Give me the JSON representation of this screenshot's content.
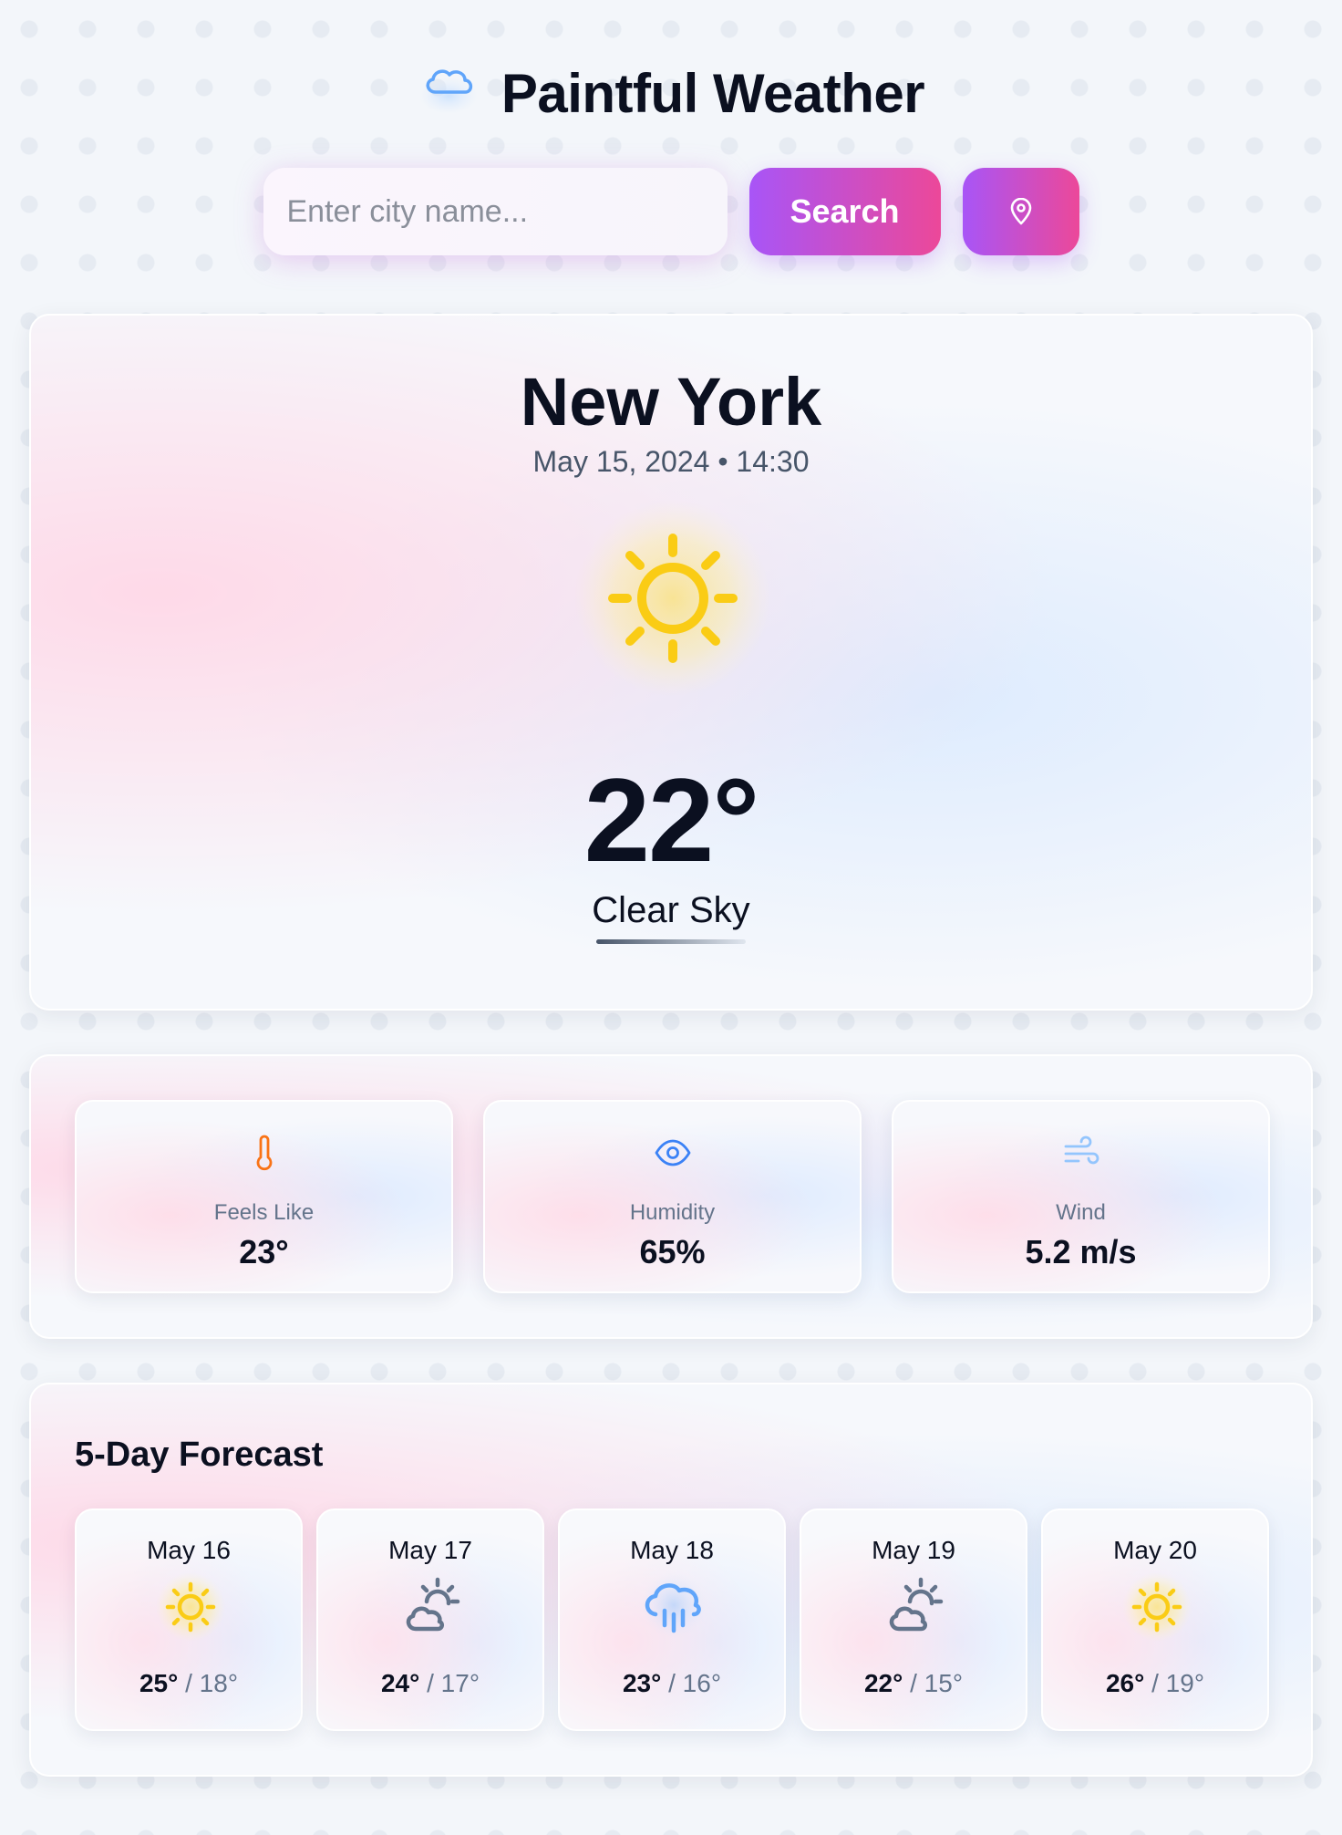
{
  "app": {
    "title": "Paintful Weather",
    "logo_icon": "cloud-icon"
  },
  "search": {
    "placeholder": "Enter city name...",
    "value": "",
    "button_label": "Search",
    "location_icon": "map-pin-icon"
  },
  "current": {
    "city": "New York",
    "datetime": "May 15, 2024 • 14:30",
    "icon": "sun-icon",
    "temperature": "22°",
    "condition": "Clear Sky"
  },
  "details": [
    {
      "label": "Feels Like",
      "value": "23°",
      "icon": "thermometer-icon",
      "color": "#f97316"
    },
    {
      "label": "Humidity",
      "value": "65%",
      "icon": "eye-icon",
      "color": "#3b82f6"
    },
    {
      "label": "Wind",
      "value": "5.2 m/s",
      "icon": "wind-icon",
      "color": "#93c5fd"
    }
  ],
  "forecast": {
    "title": "5-Day Forecast",
    "days": [
      {
        "date": "May 16",
        "icon": "sun-icon",
        "high": "25°",
        "low": "18°"
      },
      {
        "date": "May 17",
        "icon": "partly-cloudy-icon",
        "high": "24°",
        "low": "17°"
      },
      {
        "date": "May 18",
        "icon": "rain-icon",
        "high": "23°",
        "low": "16°"
      },
      {
        "date": "May 19",
        "icon": "partly-cloudy-icon",
        "high": "22°",
        "low": "15°"
      },
      {
        "date": "May 20",
        "icon": "sun-icon",
        "high": "26°",
        "low": "19°"
      }
    ],
    "separator": "/"
  },
  "colors": {
    "accent_start": "#a855f7",
    "accent_end": "#ec4899",
    "sun": "#facc15",
    "rain": "#60a5fa",
    "cloud": "#64748b"
  }
}
